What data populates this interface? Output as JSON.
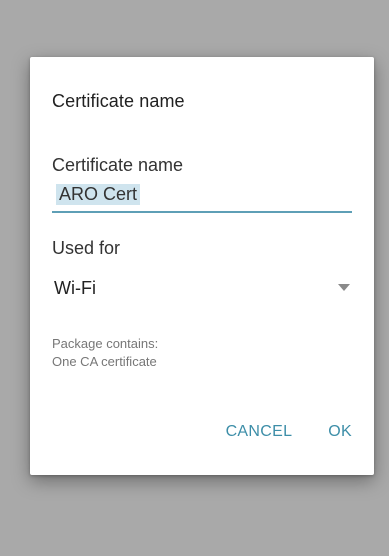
{
  "dialog": {
    "title": "Certificate name",
    "name_label": "Certificate name",
    "name_value": "ARO Cert",
    "used_for_label": "Used for",
    "used_for_value": "Wi-Fi",
    "info_line1": "Package contains:",
    "info_line2": "One CA certificate",
    "cancel_label": "CANCEL",
    "ok_label": "OK",
    "dropdown_icon": "chevron-down-icon"
  },
  "colors": {
    "accent": "#3d8ea8",
    "input_underline": "#5e9fb6",
    "selection_highlight": "#cfe4ee",
    "scrim": "#a9a9a9"
  }
}
